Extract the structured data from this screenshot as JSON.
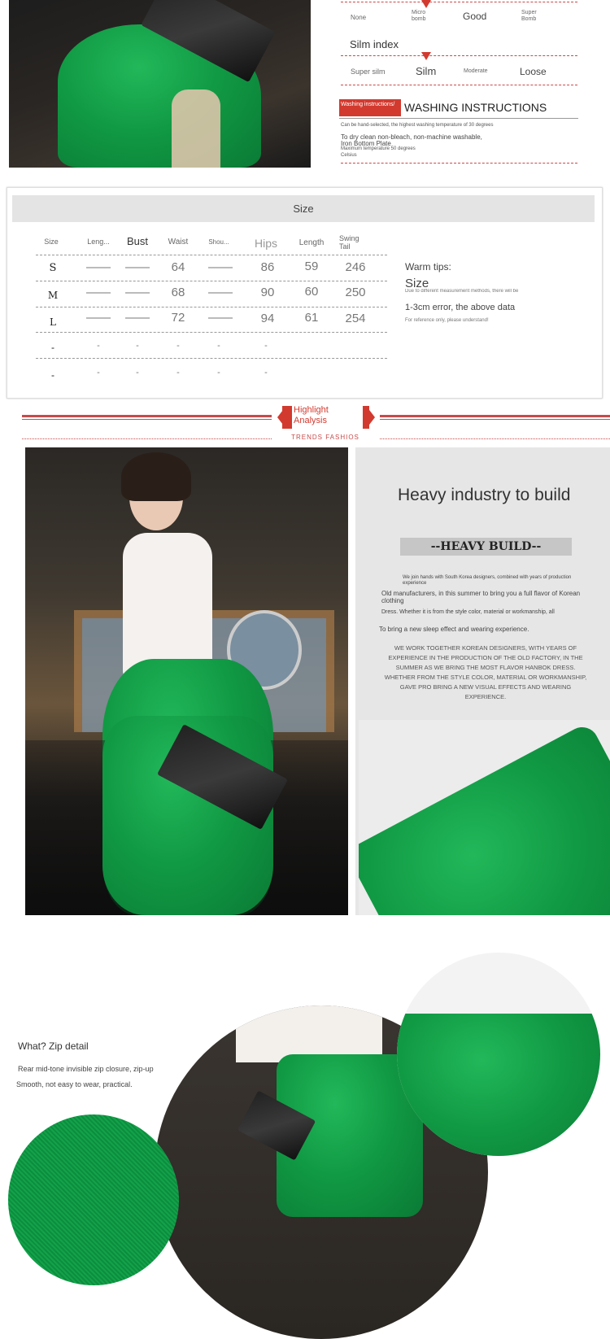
{
  "fabric_scale": {
    "labels": [
      "None",
      "Micro bomb",
      "Good",
      "Super Bomb"
    ]
  },
  "silm_index": {
    "title": "Silm index",
    "labels": [
      "Super silm",
      "Silm",
      "Moderate",
      "Loose"
    ]
  },
  "washing": {
    "badge": "Washing instructions/",
    "title": "WASHING INSTRUCTIONS",
    "lines": [
      "Can be hand-selected, the highest washing temperature of 30 degrees",
      "To dry clean non-bleach, non-machine washable,",
      "Iron Bottom Plate",
      "Maximum temperature 50 degrees",
      "Celsius"
    ]
  },
  "size_table": {
    "title": "Size",
    "headers": [
      "Size",
      "Leng...",
      "Bust",
      "Waist",
      "Shou...",
      "Hips",
      "Length",
      "Swing Tail"
    ],
    "rows": [
      [
        "S",
        "——",
        "——",
        "64",
        "——",
        "86",
        "59",
        "246"
      ],
      [
        "M",
        "——",
        "——",
        "68",
        "——",
        "90",
        "60",
        "250"
      ],
      [
        "L",
        "——",
        "——",
        "72",
        "——",
        "94",
        "61",
        "254"
      ],
      [
        "-",
        "-",
        "-",
        "-",
        "-",
        "-",
        "",
        ""
      ],
      [
        "-",
        "-",
        "-",
        "-",
        "-",
        "-",
        "",
        ""
      ]
    ]
  },
  "warm_tips": {
    "title": "Warm tips:",
    "size_label": "Size",
    "note": "Due to different measurement methods, there will be",
    "error": "1-3cm error, the above data",
    "reference": "For reference only, please understand!"
  },
  "highlight": {
    "label": "Highlight Analysis",
    "subtitle": "TRENDS FASHIOS"
  },
  "heavy": {
    "title": "Heavy industry to build",
    "banner": "--HEAVY BUILD--",
    "p1": "We join hands with South Korea designers, combined with years of production experience",
    "p2": "Old manufacturers, in this summer to bring you a full flavor of Korean clothing",
    "p3": "Dress. Whether it is from the style color, material or workmanship, all",
    "p4": "To bring a new sleep effect and wearing experience.",
    "caps": "WE WORK TOGETHER KOREAN DESIGNERS, WITH YEARS OF EXPERIENCE IN THE PRODUCTION OF THE OLD FACTORY, IN THE SUMMER AS WE BRING THE MOST FLAVOR HANBOK DRESS. WHETHER FROM THE STYLE COLOR, MATERIAL OR WORKMANSHIP, GAVE PRO BRING A NEW VISUAL EFFECTS AND WEARING EXPERIENCE."
  },
  "zip": {
    "title": "What? Zip detail",
    "line1": "Rear mid-tone invisible zip closure, zip-up",
    "line2": "Smooth, not easy to wear, practical."
  },
  "colors": {
    "accent_red": "#d23a2f",
    "skirt_green": "#119a44",
    "panel_gray": "#e4e4e4"
  }
}
